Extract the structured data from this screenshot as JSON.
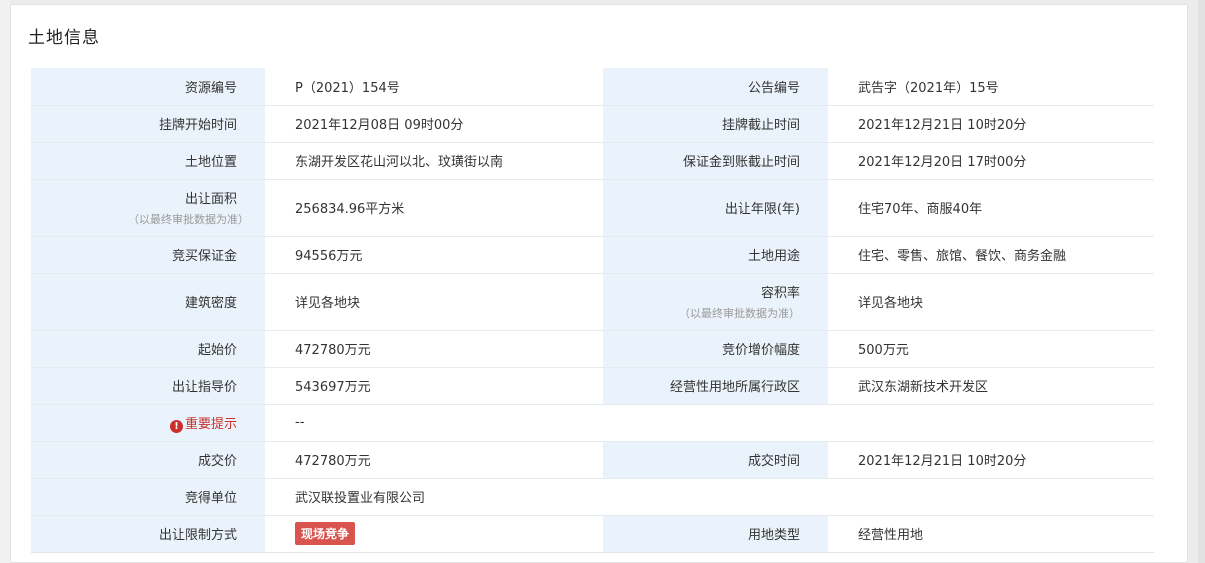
{
  "title": "土地信息",
  "rows": [
    {
      "l1": "资源编号",
      "v1": "P（2021）154号",
      "l2": "公告编号",
      "v2": "武告字（2021年）15号"
    },
    {
      "l1": "挂牌开始时间",
      "v1": "2021年12月08日 09时00分",
      "l2": "挂牌截止时间",
      "v2": "2021年12月21日 10时20分"
    },
    {
      "l1": "土地位置",
      "v1": "东湖开发区花山河以北、玟璜街以南",
      "l2": "保证金到账截止时间",
      "v2": "2021年12月20日 17时00分"
    },
    {
      "l1": "出让面积",
      "n1": "（以最终审批数据为准）",
      "v1": "256834.96平方米",
      "l2": "出让年限(年)",
      "v2": "住宅70年、商服40年"
    },
    {
      "l1": "竞买保证金",
      "v1": "94556万元",
      "l2": "土地用途",
      "v2": "住宅、零售、旅馆、餐饮、商务金融"
    },
    {
      "l1": "建筑密度",
      "v1": "详见各地块",
      "l2": "容积率",
      "n2": "（以最终审批数据为准）",
      "v2": "详见各地块"
    },
    {
      "l1": "起始价",
      "v1": "472780万元",
      "l2": "竞价增价幅度",
      "v2": "500万元"
    },
    {
      "l1": "出让指导价",
      "v1": "543697万元",
      "l2": "经营性用地所属行政区",
      "v2": "武汉东湖新技术开发区"
    },
    {
      "l1": "重要提示",
      "v1": "--"
    },
    {
      "l1": "成交价",
      "v1": "472780万元",
      "l2": "成交时间",
      "v2": "2021年12月21日 10时20分"
    },
    {
      "l1": "竞得单位",
      "v1": "武汉联投置业有限公司"
    },
    {
      "l1": "出让限制方式",
      "v1": "现场竞争",
      "l2": "用地类型",
      "v2": "经营性用地"
    }
  ],
  "icons": {
    "warning": "exclamation-circle-icon"
  },
  "colors": {
    "label_bg": "#eaf3fb",
    "warning": "#c9302c",
    "tag_bg": "#d9534f"
  }
}
